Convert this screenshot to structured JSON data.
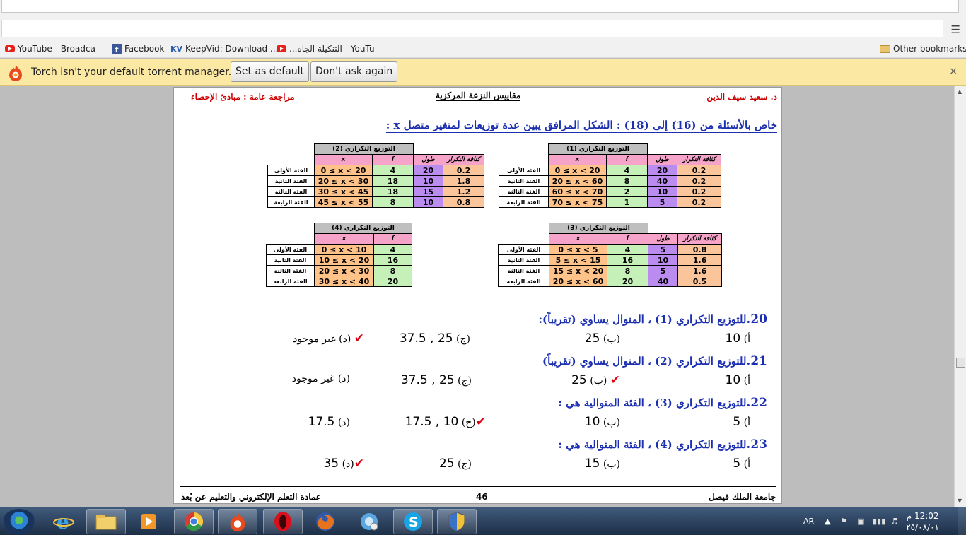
{
  "browser": {
    "menu_icon": "hamburger-menu-icon",
    "bookmarks": [
      {
        "label": "YouTube - Broadca",
        "icon": "youtube-icon"
      },
      {
        "label": "Facebook",
        "icon": "facebook-icon"
      },
      {
        "label": "KeepVid: Download ...",
        "icon": "keepvid-icon",
        "badge": "KV"
      },
      {
        "label": "...التنكيلة الجاه - YouTu",
        "icon": "youtube-icon"
      }
    ],
    "other_bookmarks": "Other bookmarks",
    "fb_letter": "f"
  },
  "infobar": {
    "message": "Torch isn't your default torrent manager.",
    "set_default": "Set as default",
    "dont_ask": "Don't ask again",
    "close": "×"
  },
  "doc": {
    "header_right": "د. سعيد سيف الدين",
    "header_center": "مقاييس النزعة المركزية",
    "header_left": "مراجعة عامة : مبادئ الإحصاء",
    "intro": "خاص بالأسئلة من (16) إلى (18) : الشكل المرافق يبين عدة توزيعات لمتغير متصل x :",
    "footer_right": "جامعة الملك فيصل",
    "footer_center": "46",
    "footer_left": "عمادة التعلم الإلكتروني والتعليم عن بُعد"
  },
  "tables": {
    "t1": {
      "caption": "التوزيع التكراري (1)",
      "headers": [
        "x",
        "f",
        "طول",
        "كثافة التكرار"
      ],
      "rows": [
        {
          "label": "الفئة الأولى",
          "x": "0 ≤ x < 20",
          "f": "4",
          "len": "20",
          "dens": "0.2"
        },
        {
          "label": "الفئة الثانية",
          "x": "20 ≤ x < 60",
          "f": "8",
          "len": "40",
          "dens": "0.2"
        },
        {
          "label": "الفئة الثالثة",
          "x": "60 ≤ x < 70",
          "f": "2",
          "len": "10",
          "dens": "0.2"
        },
        {
          "label": "الفئة الرابعة",
          "x": "70 ≤ x < 75",
          "f": "1",
          "len": "5",
          "dens": "0.2"
        }
      ]
    },
    "t2": {
      "caption": "التوزيع التكراري (2)",
      "headers": [
        "x",
        "f",
        "طول",
        "كثافة التكرار"
      ],
      "rows": [
        {
          "label": "الفئة الأولى",
          "x": "0 ≤ x < 20",
          "f": "4",
          "len": "20",
          "dens": "0.2"
        },
        {
          "label": "الفئة الثانية",
          "x": "20 ≤ x < 30",
          "f": "18",
          "len": "10",
          "dens": "1.8"
        },
        {
          "label": "الفئة الثالثة",
          "x": "30 ≤ x < 45",
          "f": "18",
          "len": "15",
          "dens": "1.2"
        },
        {
          "label": "الفئة الرابعة",
          "x": "45 ≤ x < 55",
          "f": "8",
          "len": "10",
          "dens": "0.8"
        }
      ]
    },
    "t3": {
      "caption": "التوزيع التكراري (3)",
      "headers": [
        "x",
        "f",
        "طول",
        "كثافة التكرار"
      ],
      "rows": [
        {
          "label": "الفئة الأولى",
          "x": "0 ≤ x < 5",
          "f": "4",
          "len": "5",
          "dens": "0.8"
        },
        {
          "label": "الفئة الثانية",
          "x": "5 ≤ x < 15",
          "f": "16",
          "len": "10",
          "dens": "1.6"
        },
        {
          "label": "الفئة الثالثة",
          "x": "15 ≤ x < 20",
          "f": "8",
          "len": "5",
          "dens": "1.6"
        },
        {
          "label": "الفئة الرابعة",
          "x": "20 ≤ x < 60",
          "f": "20",
          "len": "40",
          "dens": "0.5"
        }
      ]
    },
    "t4": {
      "caption": "التوزيع التكراري (4)",
      "headers": [
        "x",
        "f"
      ],
      "rows": [
        {
          "label": "الفئة الأولى",
          "x": "0 ≤ x < 10",
          "f": "4"
        },
        {
          "label": "الفئة الثانية",
          "x": "10 ≤ x < 20",
          "f": "16"
        },
        {
          "label": "الفئة الثالثة",
          "x": "20 ≤ x < 30",
          "f": "8"
        },
        {
          "label": "الفئة الرابعة",
          "x": "30 ≤ x < 40",
          "f": "20"
        }
      ]
    }
  },
  "questions": [
    {
      "num": "20.",
      "text": "للتوزيع التكراري (1) ، المنوال يساوي (تقريباً):",
      "a_label": "أ)",
      "a_val": "10",
      "b_label": "(ب)",
      "b_val": "25",
      "c_label": "(ج)",
      "c_val": "25 , 37.5",
      "d_label": "(د)",
      "d_val": "غير موجود",
      "correct": "d"
    },
    {
      "num": "21.",
      "text": "للتوزيع التكراري (2) ، المنوال يساوي (تقريباً)",
      "a_label": "أ)",
      "a_val": "10",
      "b_label": "(ب)",
      "b_val": "25",
      "c_label": "(ج)",
      "c_val": "25 , 37.5",
      "d_label": "(د)",
      "d_val": "غير موجود",
      "correct": "b"
    },
    {
      "num": "22.",
      "text": "للتوزيع التكراري (3) ، الفئة المنوالية هي :",
      "a_label": "أ)",
      "a_val": "5",
      "b_label": "(ب)",
      "b_val": "10",
      "c_label": "(ج)",
      "c_val": "10 , 17.5",
      "d_label": "(د)",
      "d_val": "17.5",
      "correct": "c"
    },
    {
      "num": "23.",
      "text": "للتوزيع التكراري (4) ، الفئة المنوالية هي :",
      "a_label": "أ)",
      "a_val": "5",
      "b_label": "(ب)",
      "b_val": "15",
      "c_label": "(ج)",
      "c_val": "25",
      "d_label": "(د)",
      "d_val": "35",
      "correct": "d"
    }
  ],
  "check_mark": "✔",
  "taskbar": {
    "lang": "AR",
    "time": "12:02 م",
    "date": "٢٥/٠٨/٠١",
    "apps": [
      "internet-explorer-icon",
      "file-explorer-icon",
      "media-player-icon",
      "chrome-icon",
      "torch-icon",
      "opera-icon",
      "firefox-icon",
      "network-icon",
      "skype-icon",
      "shield-icon"
    ]
  }
}
